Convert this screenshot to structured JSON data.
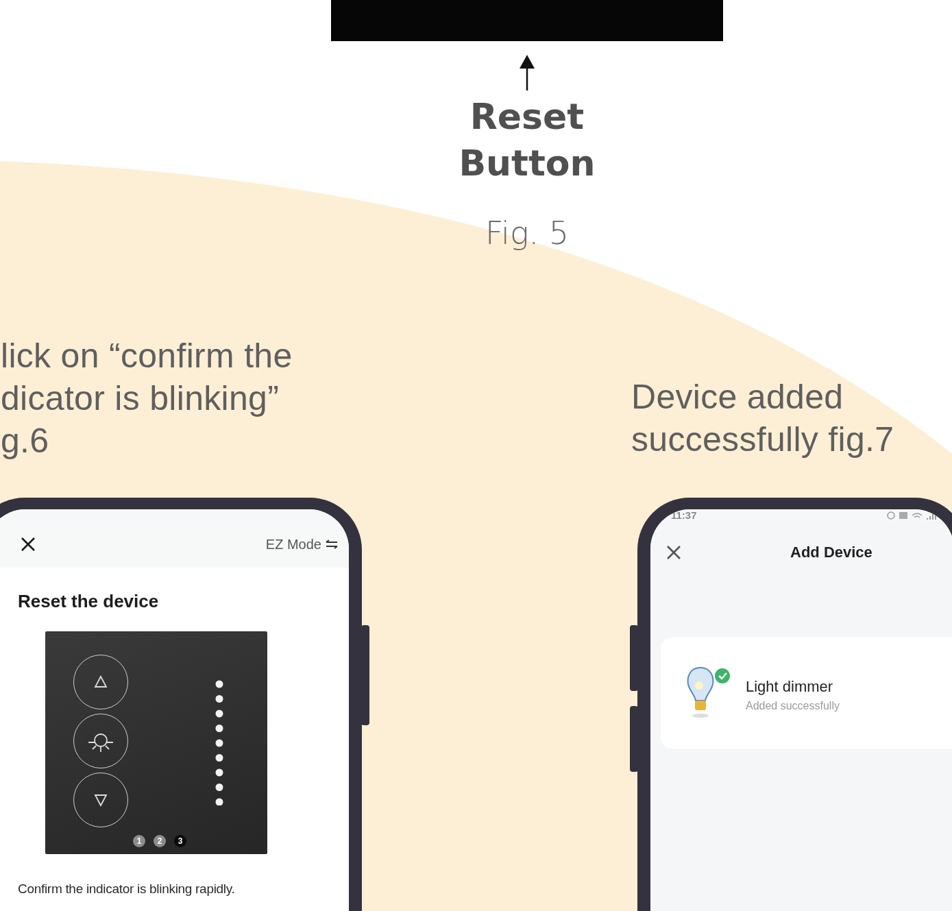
{
  "reset_label": [
    "Reset",
    "Button"
  ],
  "figure_caption": "Fig. 5",
  "step_left": [
    "lick on “confirm the",
    "dicator is blinking”",
    "g.6"
  ],
  "step_right": [
    "Device added",
    "successfully  fig.7"
  ],
  "phone_left": {
    "mode_switch": "EZ Mode",
    "title": "Reset the device",
    "pages": [
      {
        "label": "1",
        "selected": false
      },
      {
        "label": "2",
        "selected": false
      },
      {
        "label": "3",
        "selected": true
      }
    ],
    "caption": "Confirm the indicator is blinking rapidly."
  },
  "phone_right": {
    "status_time": "11:37",
    "title": "Add Device",
    "device": {
      "name": "Light dimmer",
      "status": "Added successfully"
    }
  }
}
